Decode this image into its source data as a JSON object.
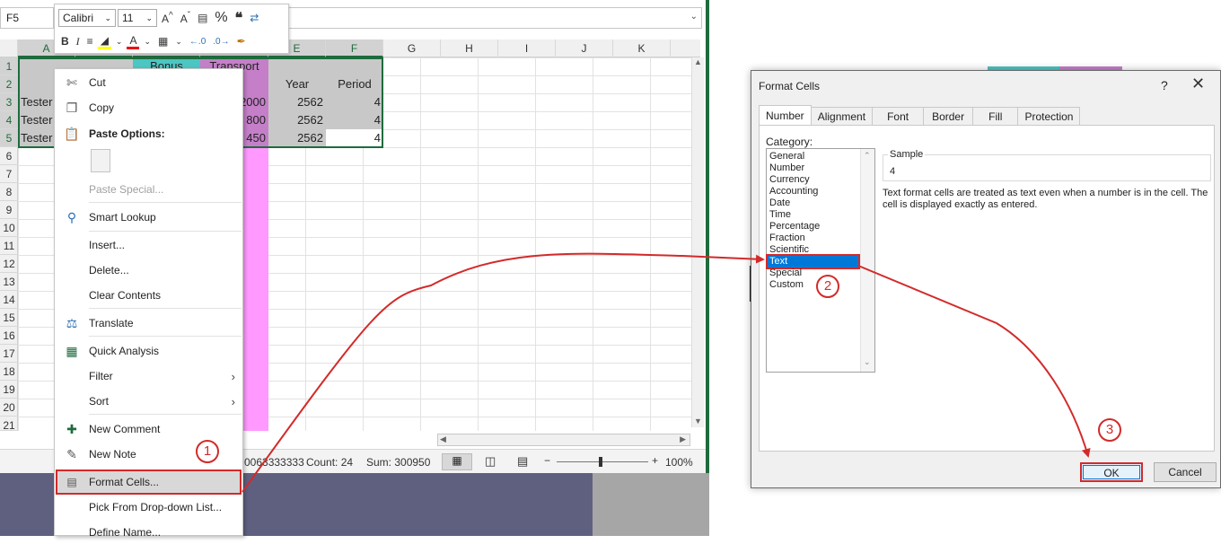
{
  "namebox": "F5",
  "mini_toolbar": {
    "font": "Calibri",
    "size": "11"
  },
  "columns": [
    "A",
    "B",
    "C",
    "D",
    "E",
    "F",
    "G",
    "H",
    "I",
    "J",
    "K"
  ],
  "rows": [
    "1",
    "2",
    "3",
    "4",
    "5",
    "6",
    "7",
    "8",
    "9",
    "10",
    "11",
    "12",
    "13",
    "14",
    "15",
    "16",
    "17",
    "18",
    "19",
    "20",
    "21"
  ],
  "cells": {
    "c1": "Bonus",
    "d1": "Transport",
    "e2": "Year",
    "f2": "Period",
    "a3": "Tester",
    "a4": "Tester",
    "a5": "Tester",
    "d3": "2000",
    "d4": "800",
    "d5": "450",
    "e3": "2562",
    "e4": "2562",
    "e5": "2562",
    "f3": "4",
    "f4": "4",
    "f5": "4"
  },
  "status": {
    "average": "0063333333",
    "count": "Count: 24",
    "sum": "Sum: 300950",
    "zoom": "100%"
  },
  "context_menu": {
    "cut": "Cut",
    "copy": "Copy",
    "paste_options": "Paste Options:",
    "paste_special": "Paste Special...",
    "smart_lookup": "Smart Lookup",
    "insert": "Insert...",
    "delete": "Delete...",
    "clear_contents": "Clear Contents",
    "translate": "Translate",
    "quick_analysis": "Quick Analysis",
    "filter": "Filter",
    "sort": "Sort",
    "new_comment": "New Comment",
    "new_note": "New Note",
    "format_cells": "Format Cells...",
    "pick_list": "Pick From Drop-down List...",
    "define_name": "Define Name..."
  },
  "dialog": {
    "title": "Format Cells",
    "help": "?",
    "tabs": [
      "Number",
      "Alignment",
      "Font",
      "Border",
      "Fill",
      "Protection"
    ],
    "category_label": "Category:",
    "categories": [
      "General",
      "Number",
      "Currency",
      "Accounting",
      "Date",
      "Time",
      "Percentage",
      "Fraction",
      "Scientific",
      "Text",
      "Special",
      "Custom"
    ],
    "selected_category": "Text",
    "sample_label": "Sample",
    "sample_value": "4",
    "description": "Text format cells are treated as text even when a number is in the cell. The cell is displayed exactly as entered.",
    "ok": "OK",
    "cancel": "Cancel"
  },
  "steps": [
    "1",
    "2",
    "3"
  ],
  "colors": {
    "accent_green": "#1e6b3c",
    "annotation_red": "#d32a2a",
    "selection_blue": "#0078d7"
  }
}
